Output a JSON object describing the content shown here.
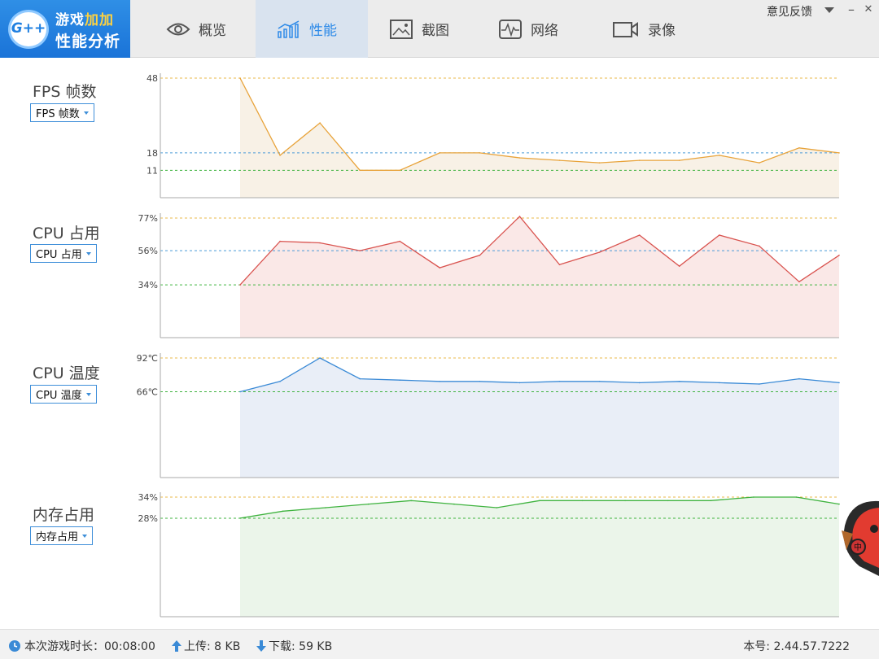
{
  "header": {
    "logo": {
      "badge": "G++",
      "line1_a": "游戏",
      "line1_b": "加加",
      "line2": "性能分析"
    },
    "tabs": [
      {
        "label": "概览",
        "icon": "eye-icon",
        "active": false
      },
      {
        "label": "性能",
        "icon": "performance-chart-icon",
        "active": true
      },
      {
        "label": "截图",
        "icon": "screenshot-icon",
        "active": false
      },
      {
        "label": "网络",
        "icon": "network-icon",
        "active": false
      },
      {
        "label": "录像",
        "icon": "video-camera-icon",
        "active": false
      }
    ],
    "feedback": "意见反馈",
    "menu_icon": "dropdown-triangle-icon",
    "minimize": "–",
    "close": "✕"
  },
  "panels": [
    {
      "title": "FPS 帧数",
      "select": "FPS 帧数",
      "color": "#e8a33a",
      "fill": "#f8f1e6"
    },
    {
      "title": "CPU 占用",
      "select": "CPU 占用",
      "color": "#d9534f",
      "fill": "#fae8e7"
    },
    {
      "title": "CPU 温度",
      "select": "CPU 温度",
      "color": "#3a8ad6",
      "fill": "#e9eef7"
    },
    {
      "title": "内存占用",
      "select": "内存占用",
      "color": "#3fb33f",
      "fill": "#ebf5ea"
    }
  ],
  "chart_data": [
    {
      "type": "area",
      "title": "FPS 帧数",
      "tick_labels": [
        "48",
        "18",
        "11"
      ],
      "reference_lines": [
        48,
        18,
        11
      ],
      "ylim": [
        0,
        48
      ],
      "values": [
        48,
        17,
        30,
        11,
        11,
        18,
        18,
        16,
        15,
        14,
        15,
        15,
        17,
        14,
        20,
        18
      ]
    },
    {
      "type": "area",
      "title": "CPU 占用",
      "tick_labels": [
        "77%",
        "56%",
        "34%"
      ],
      "reference_lines": [
        77,
        56,
        34
      ],
      "ylim": [
        0,
        77
      ],
      "values": [
        34,
        62,
        61,
        56,
        62,
        45,
        53,
        78,
        47,
        55,
        66,
        46,
        66,
        59,
        36,
        53
      ]
    },
    {
      "type": "area",
      "title": "CPU 温度",
      "tick_labels": [
        "92℃",
        "66℃"
      ],
      "reference_lines": [
        92,
        66
      ],
      "ylim": [
        0,
        92
      ],
      "values": [
        66,
        74,
        92,
        76,
        75,
        74,
        74,
        73,
        74,
        74,
        73,
        74,
        73,
        72,
        76,
        73
      ]
    },
    {
      "type": "area",
      "title": "内存占用",
      "tick_labels": [
        "34%",
        "28%"
      ],
      "reference_lines": [
        34,
        28
      ],
      "ylim": [
        0,
        34
      ],
      "values": [
        28,
        30,
        31,
        32,
        33,
        32,
        31,
        33,
        33,
        33,
        33,
        33,
        34,
        34,
        32
      ]
    }
  ],
  "status": {
    "clock_icon": "clock-icon",
    "duration_label": "本次游戏时长：00:08:00",
    "upload_icon": "upload-arrow-icon",
    "upload": "上传: 8 KB",
    "download_icon": "download-arrow-icon",
    "download": "下载: 59 KB",
    "version": "本号: 2.44.57.7222"
  },
  "mascot": {
    "badge_text": "中"
  }
}
